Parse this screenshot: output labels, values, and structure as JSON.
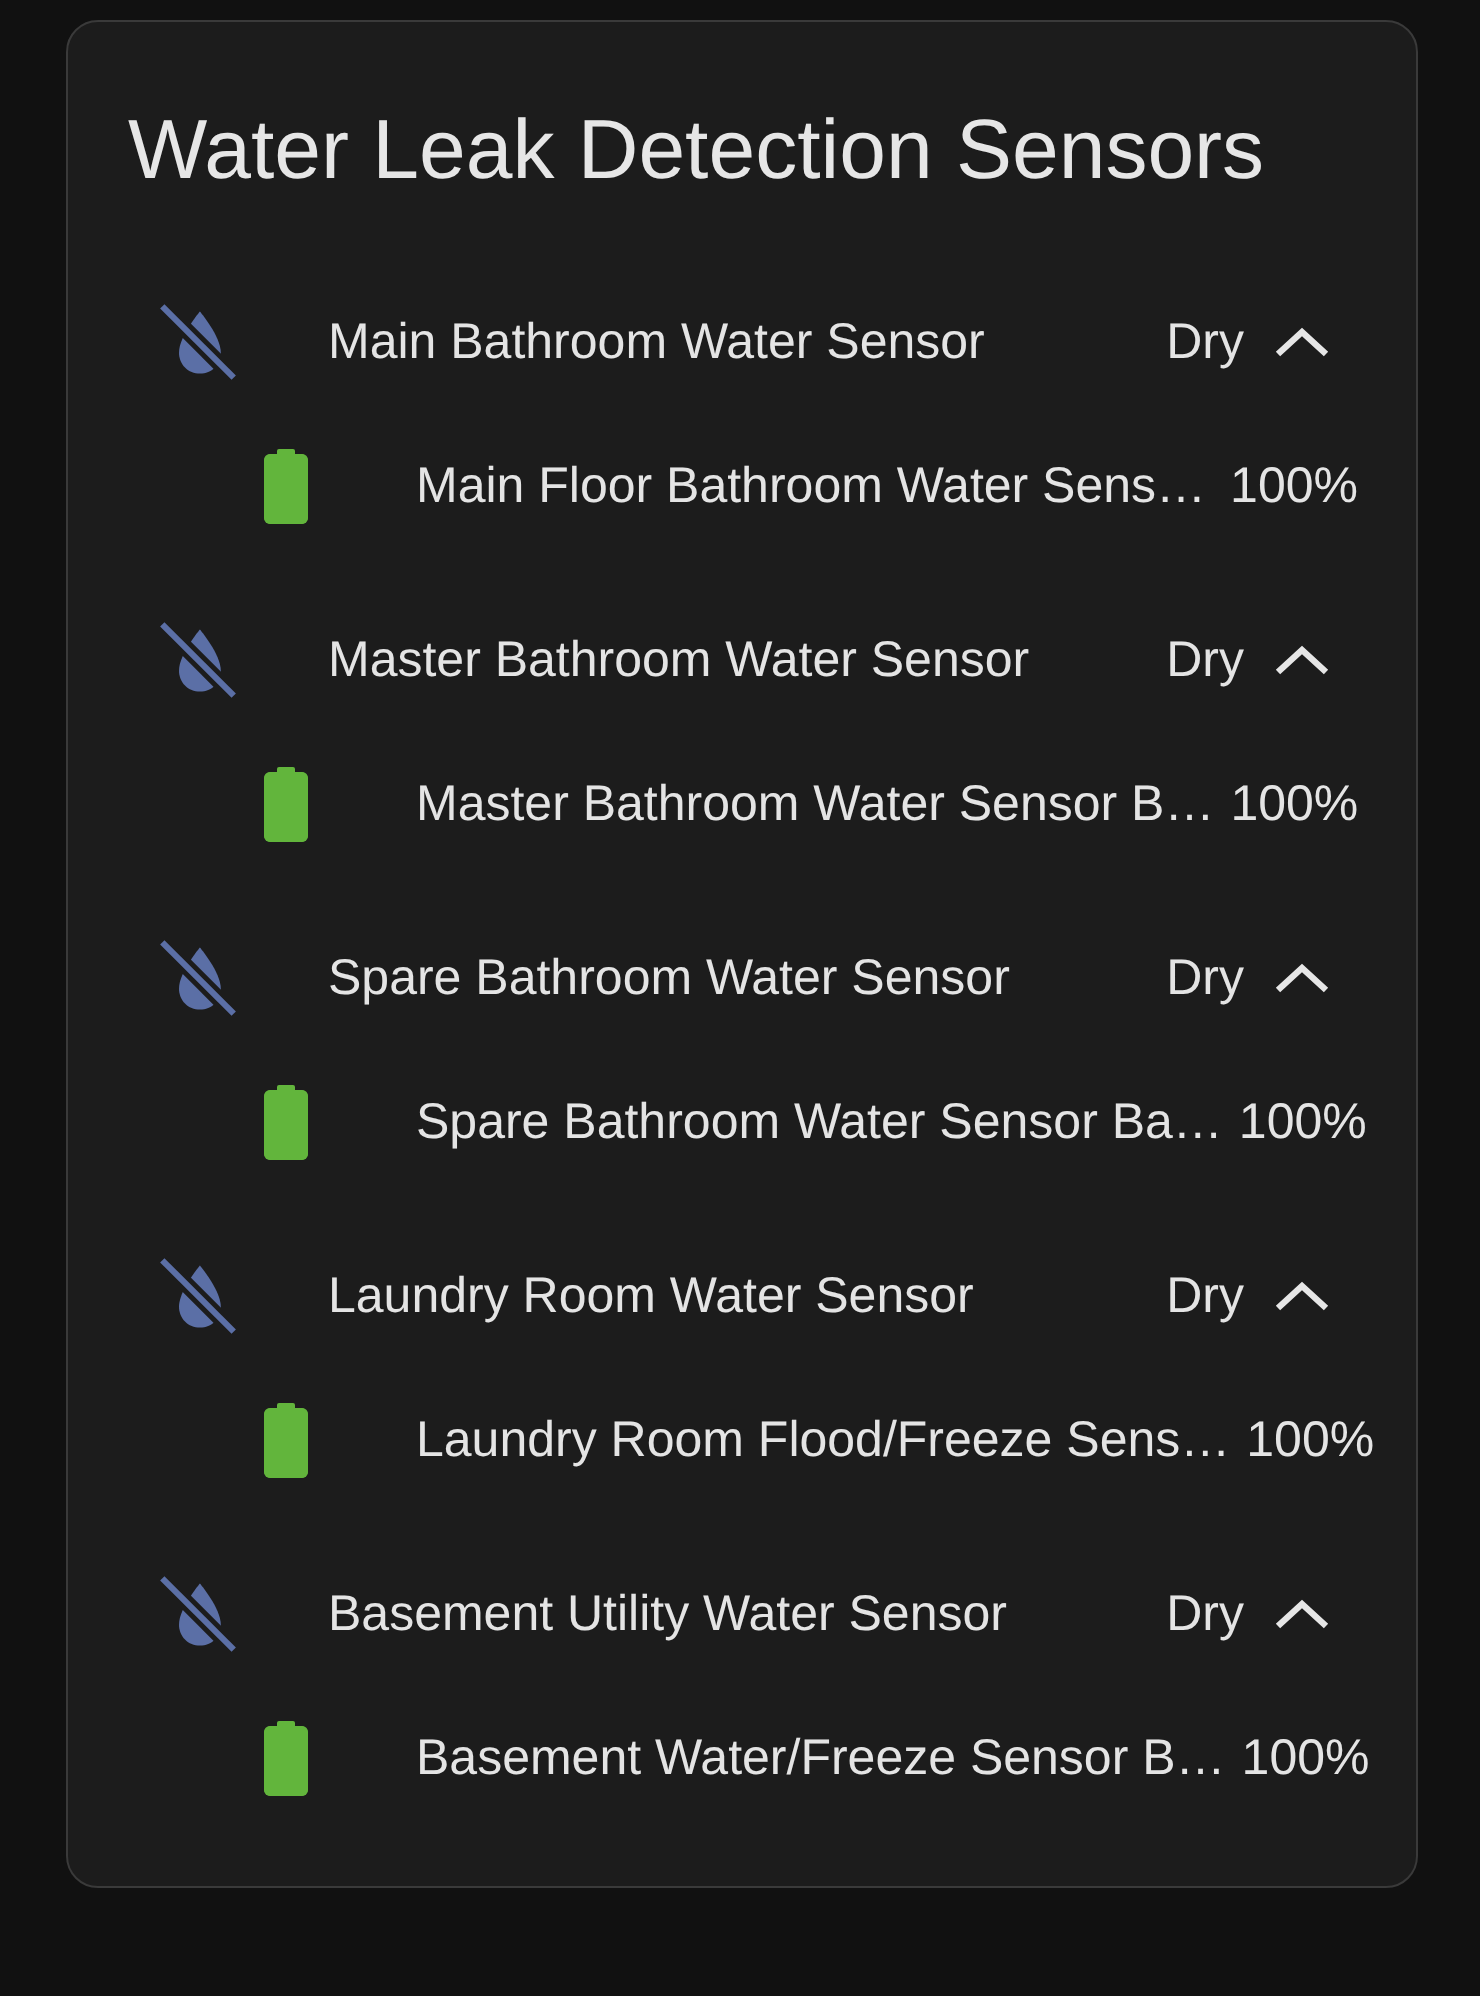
{
  "card": {
    "title": "Water Leak Detection Sensors",
    "sensors": [
      {
        "name": "Main Bathroom Water Sensor",
        "state": "Dry",
        "expanded": true,
        "children": [
          {
            "kind": "battery",
            "name": "Main Floor Bathroom Water Sens…",
            "value": "100%",
            "level": 1
          }
        ]
      },
      {
        "name": "Master Bathroom Water Sensor",
        "state": "Dry",
        "expanded": true,
        "children": [
          {
            "kind": "battery",
            "name": "Master Bathroom Water Sensor B…",
            "value": "100%",
            "level": 1
          }
        ]
      },
      {
        "name": "Spare Bathroom Water Sensor",
        "state": "Dry",
        "expanded": true,
        "children": [
          {
            "kind": "battery",
            "name": "Spare Bathroom Water Sensor Ba…",
            "value": "100%",
            "level": 1
          }
        ]
      },
      {
        "name": "Laundry Room Water Sensor",
        "state": "Dry",
        "expanded": true,
        "children": [
          {
            "kind": "battery",
            "name": "Laundry Room Flood/Freeze Sens…",
            "value": "100%",
            "level": 1
          }
        ]
      },
      {
        "name": "Basement Utility Water Sensor",
        "state": "Dry",
        "expanded": true,
        "children": [
          {
            "kind": "battery",
            "name": "Basement Water/Freeze Sensor B…",
            "value": "100%",
            "level": 1
          }
        ]
      }
    ]
  }
}
